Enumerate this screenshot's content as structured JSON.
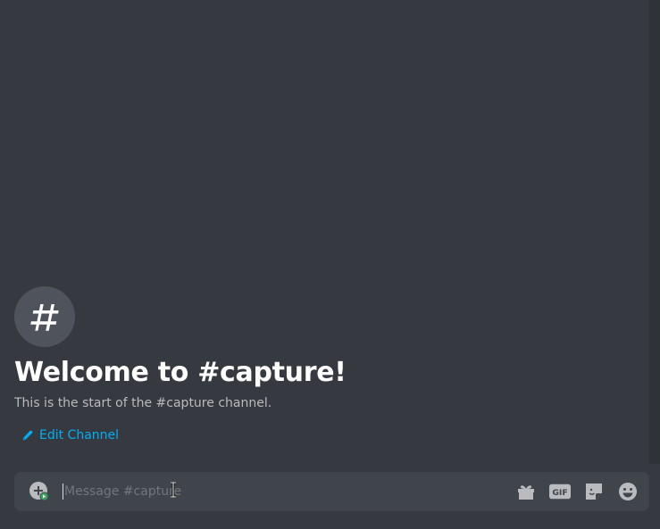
{
  "welcome": {
    "channel_symbol": "#",
    "title": "Welcome to #capture!",
    "subtitle": "This is the start of the #capture channel.",
    "edit_channel_label": "Edit Channel"
  },
  "composer": {
    "placeholder": "Message #capture",
    "gif_label": "GIF",
    "icons": [
      "attach-plus-icon",
      "gift-icon",
      "gif-icon",
      "sticker-icon",
      "emoji-icon"
    ]
  },
  "colors": {
    "background": "#36393f",
    "composer_bg": "#40444b",
    "link": "#00b0f4",
    "icon": "#b9bbbe",
    "title": "#ffffff"
  }
}
